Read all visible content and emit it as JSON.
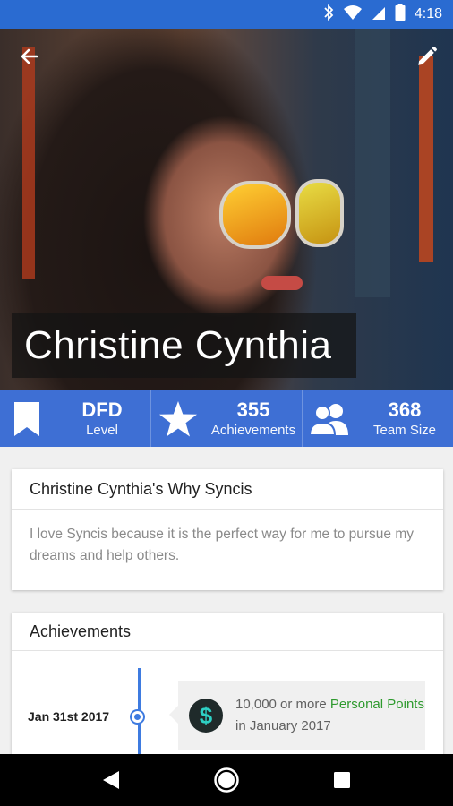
{
  "status_bar": {
    "time": "4:18",
    "icons": [
      "bluetooth-icon",
      "wifi-icon",
      "signal-icon",
      "battery-icon"
    ]
  },
  "header": {
    "back_icon": "arrow-left-icon",
    "edit_icon": "pencil-icon",
    "profile_name": "Christine Cynthia"
  },
  "stats": [
    {
      "icon": "bookmark-icon",
      "value": "DFD",
      "label": "Level"
    },
    {
      "icon": "star-icon",
      "value": "355",
      "label": "Achievements"
    },
    {
      "icon": "people-icon",
      "value": "368",
      "label": "Team Size"
    }
  ],
  "why_card": {
    "title": "Christine Cynthia's Why Syncis",
    "body": "I love Syncis because it is the perfect way for me to pursue my dreams and help others."
  },
  "achievements_card": {
    "title": "Achievements",
    "items": [
      {
        "date": "Jan 31st 2017",
        "icon_symbol": "$",
        "text_before": "10,000 or more ",
        "highlight": "Personal Points",
        "text_after": " in January 2017"
      }
    ]
  },
  "colors": {
    "primary": "#3e6fd4",
    "status_bar": "#2a6bd1",
    "highlight_green": "#2e9a2e"
  }
}
